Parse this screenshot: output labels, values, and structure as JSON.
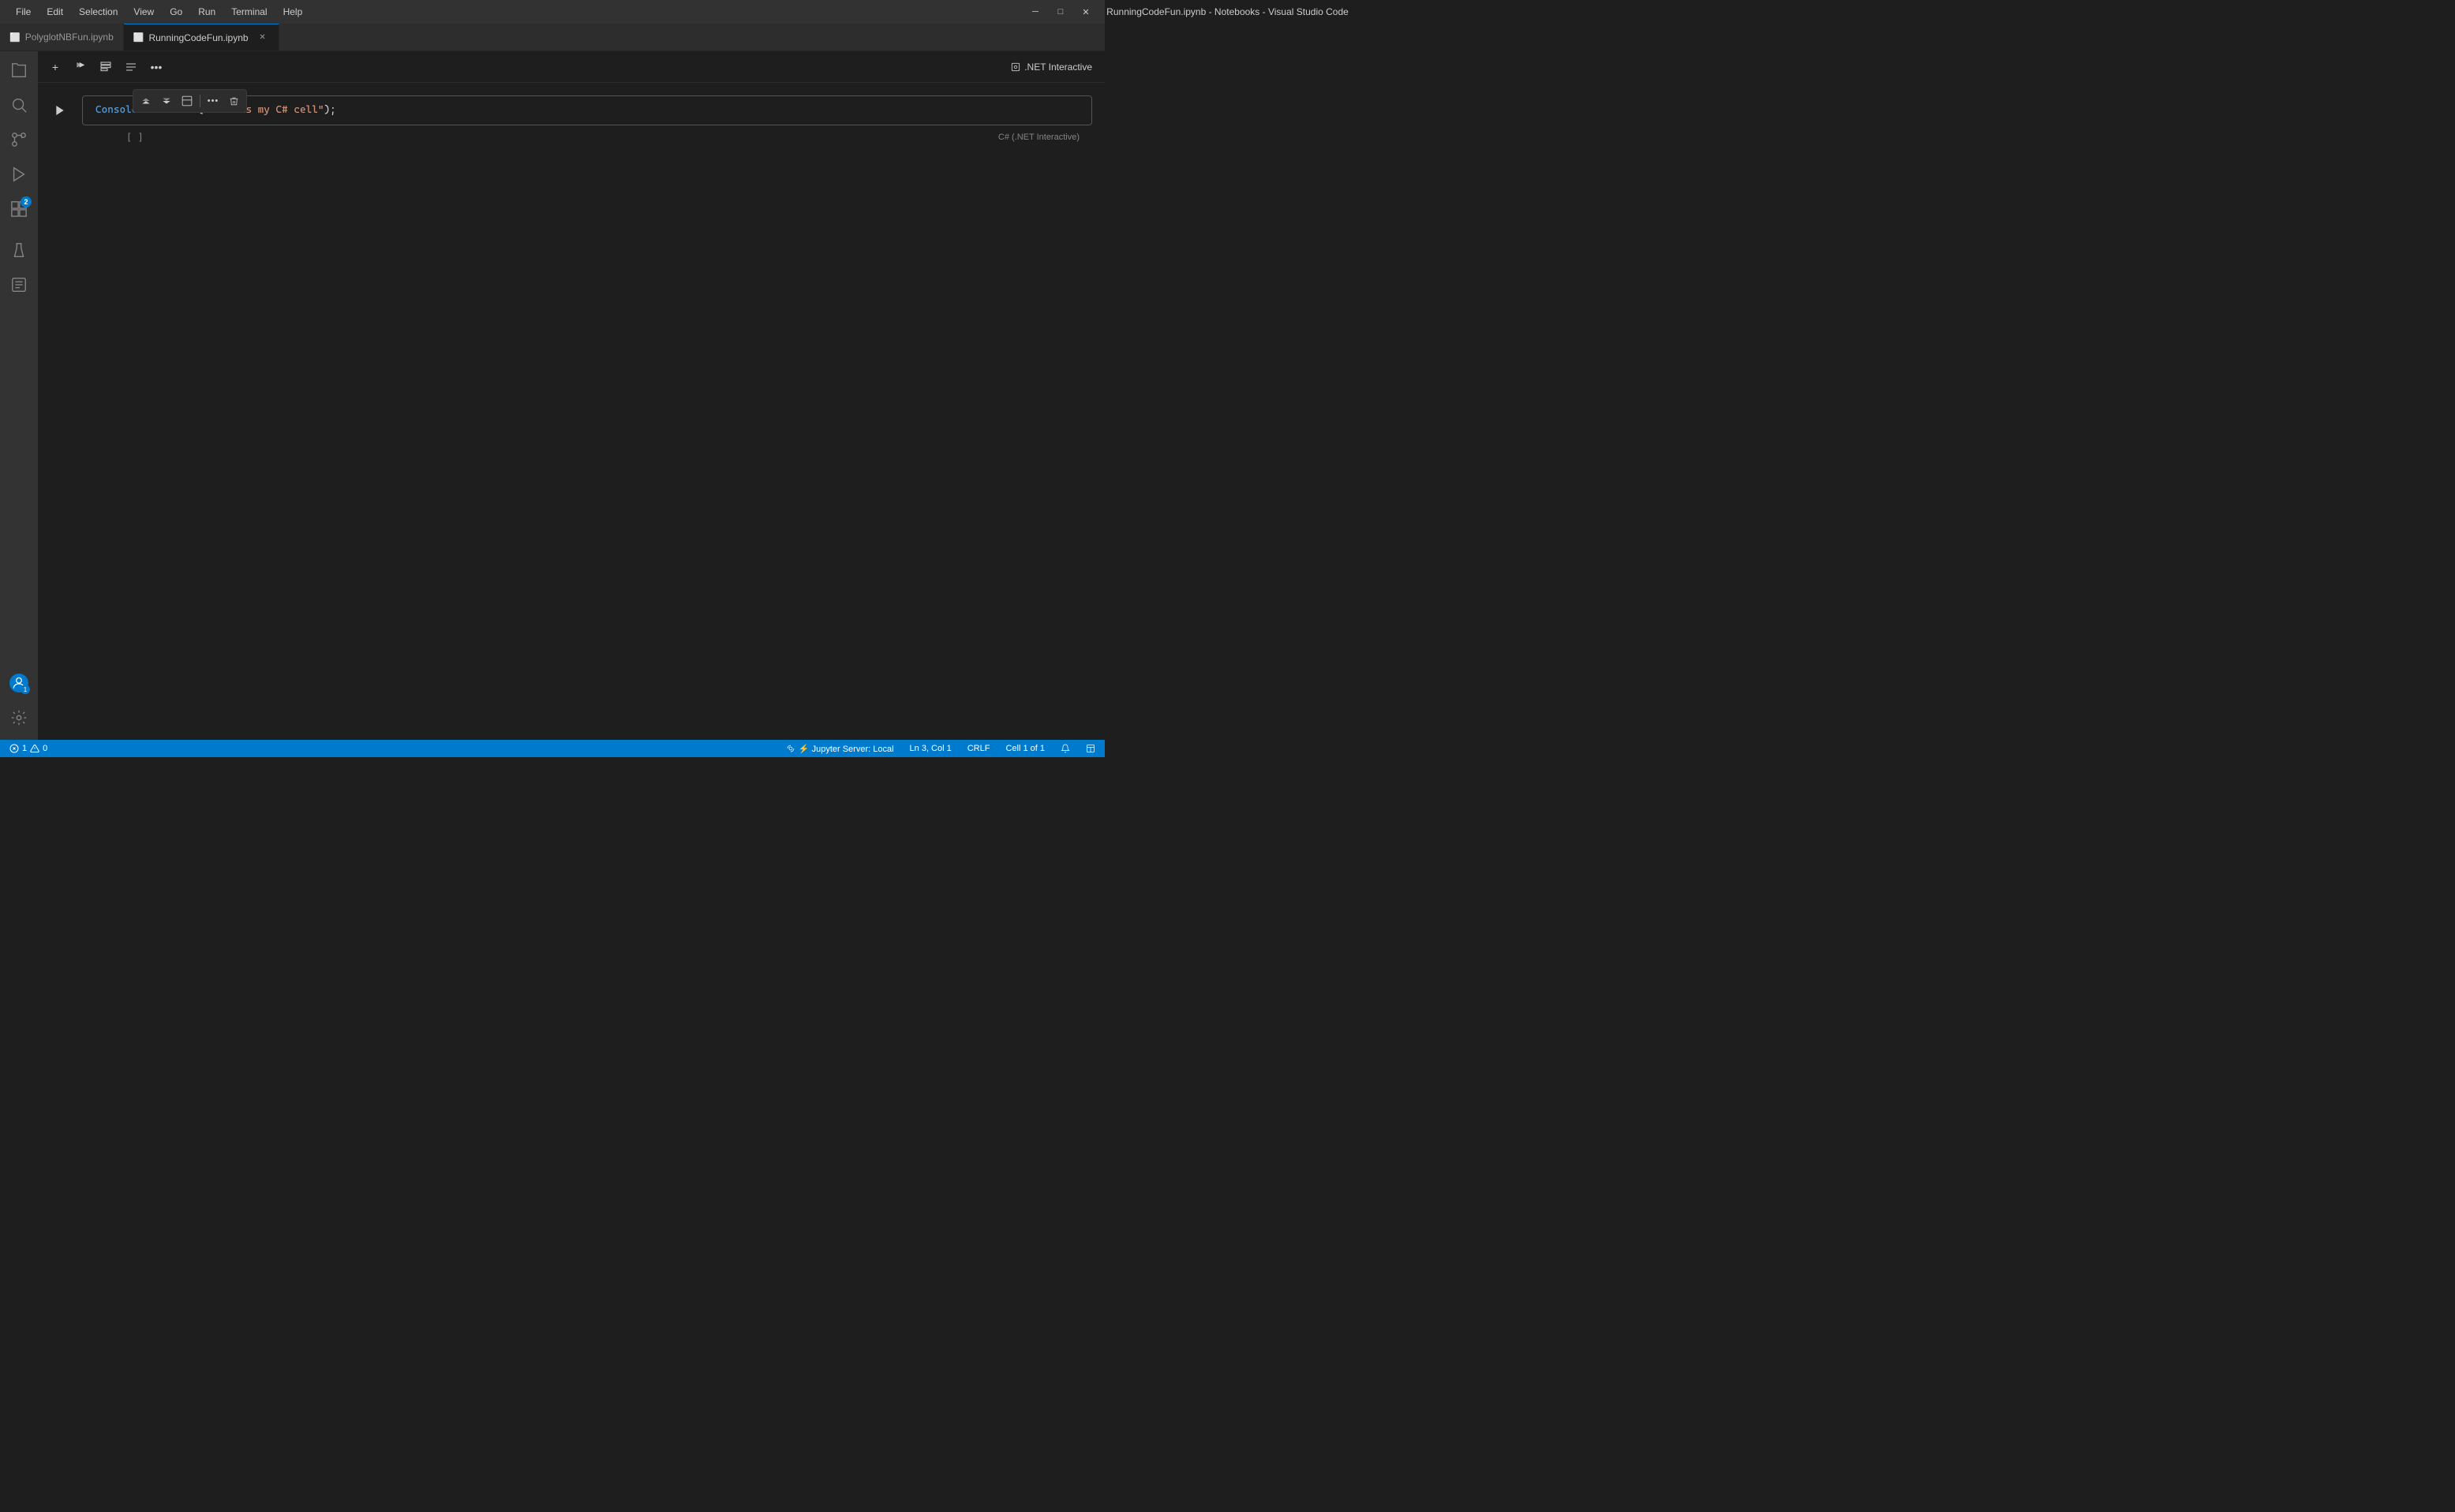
{
  "window": {
    "title": "RunningCodeFun.ipynb - Notebooks - Visual Studio Code"
  },
  "menu": {
    "items": [
      "File",
      "Edit",
      "Selection",
      "View",
      "Go",
      "Run",
      "Terminal",
      "Help"
    ]
  },
  "titlebar": {
    "controls": {
      "minimize": "─",
      "maximize": "□",
      "close": "✕"
    }
  },
  "tabs": [
    {
      "label": "PolyglotNBFun.ipynb",
      "active": false,
      "icon": "📓"
    },
    {
      "label": "RunningCodeFun.ipynb",
      "active": true,
      "icon": "📓"
    }
  ],
  "activity_bar": {
    "items": [
      {
        "id": "explorer",
        "icon": "⬜",
        "label": "Explorer"
      },
      {
        "id": "search",
        "icon": "🔍",
        "label": "Search"
      },
      {
        "id": "source-control",
        "icon": "⑂",
        "label": "Source Control"
      },
      {
        "id": "run",
        "icon": "▷",
        "label": "Run and Debug"
      },
      {
        "id": "extensions",
        "icon": "⊞",
        "label": "Extensions",
        "badge": "2"
      },
      {
        "id": "testing",
        "icon": "🧪",
        "label": "Testing"
      },
      {
        "id": "notebooks",
        "icon": "📓",
        "label": "Notebooks"
      }
    ],
    "bottom": [
      {
        "id": "accounts",
        "label": "Accounts",
        "badge": "1"
      },
      {
        "id": "settings",
        "label": "Settings"
      }
    ]
  },
  "notebook_toolbar": {
    "buttons": [
      {
        "id": "add-cell",
        "icon": "+",
        "label": "Add Cell"
      },
      {
        "id": "run-all",
        "icon": "▷",
        "label": "Run All"
      },
      {
        "id": "clear",
        "icon": "≡",
        "label": "Clear All Outputs"
      },
      {
        "id": "outline",
        "icon": "☰",
        "label": "Outline"
      },
      {
        "id": "more",
        "icon": "···",
        "label": "More Actions"
      }
    ],
    "net_interactive_label": ".NET Interactive"
  },
  "cell_toolbar": {
    "buttons": [
      {
        "id": "run-above",
        "icon": "⏮▷",
        "label": "Run Above Cells"
      },
      {
        "id": "run-below",
        "icon": "▷⏭",
        "label": "Run Cell and Below"
      },
      {
        "id": "cell-type",
        "icon": "⊞",
        "label": "Change Cell Type"
      },
      {
        "id": "more-cell",
        "icon": "···",
        "label": "More Cell Actions"
      },
      {
        "id": "delete",
        "icon": "🗑",
        "label": "Delete Cell"
      }
    ]
  },
  "cell": {
    "run_icon": "▷",
    "gutter_label": "[ ]",
    "code": {
      "keyword": "Console",
      "method": ".WriteLine",
      "open_paren": "(",
      "string": "\"This is my C# cell\"",
      "close": ");"
    },
    "language": "C# (.NET Interactive)"
  },
  "status_bar": {
    "left": {
      "errors": "⊗ 1",
      "warnings": "⚠ 0"
    },
    "right": {
      "jupyter": "⚡ Jupyter Server: Local",
      "position": "Ln 3, Col 1",
      "eol": "CRLF",
      "cell_info": "Cell 1 of 1",
      "notifications": "🔔",
      "layout": "⊞"
    }
  }
}
